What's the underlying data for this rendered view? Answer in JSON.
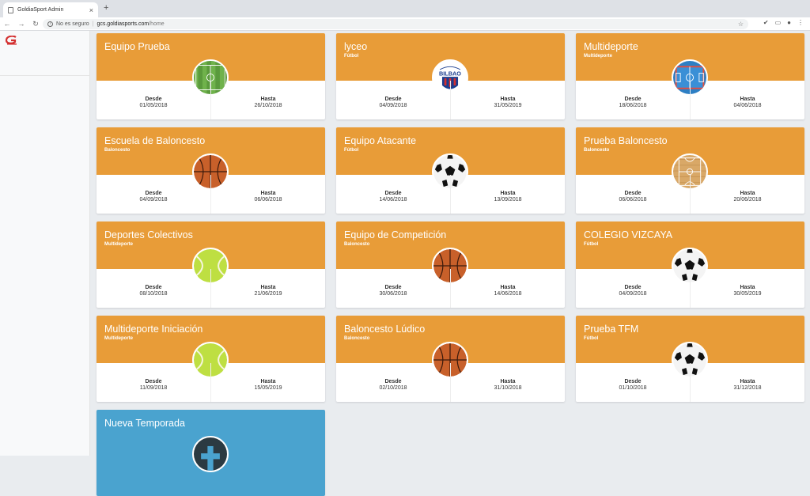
{
  "browser": {
    "tab_title": "GoldiaSport Admin",
    "security_label": "No es seguro",
    "url_host": "gcs.goldiasports.com",
    "url_path": "/home"
  },
  "colors": {
    "orange": "#e89c38",
    "blue": "#4aa3cf"
  },
  "labels": {
    "from": "Desde",
    "to": "Hasta"
  },
  "cards": [
    {
      "title": "Equipo Prueba",
      "subtitle": "",
      "icon": "field-icon",
      "from": "01/05/2018",
      "to": "26/10/2018",
      "color": "orange"
    },
    {
      "title": "lyceo",
      "subtitle": "Fútbol",
      "icon": "bilbao-crest-icon",
      "badge_text": "BILBAO",
      "from": "04/09/2018",
      "to": "31/05/2019",
      "color": "orange"
    },
    {
      "title": "Multideporte",
      "subtitle": "Multideporte",
      "icon": "court-icon",
      "from": "18/06/2018",
      "to": "04/06/2018",
      "color": "orange"
    },
    {
      "title": "Escuela de Baloncesto",
      "subtitle": "Baloncesto",
      "icon": "basketball-icon",
      "from": "04/09/2018",
      "to": "06/06/2018",
      "color": "orange"
    },
    {
      "title": "Equipo Atacante",
      "subtitle": "Fútbol",
      "icon": "soccer-ball-icon",
      "from": "14/06/2018",
      "to": "13/09/2018",
      "color": "orange"
    },
    {
      "title": "Prueba Baloncesto",
      "subtitle": "Baloncesto",
      "icon": "wood-court-icon",
      "from": "06/06/2018",
      "to": "20/06/2018",
      "color": "orange"
    },
    {
      "title": "Deportes Colectivos",
      "subtitle": "Multideporte",
      "icon": "tennis-ball-icon",
      "from": "08/10/2018",
      "to": "21/06/2019",
      "color": "orange"
    },
    {
      "title": "Equipo de Competición",
      "subtitle": "Baloncesto",
      "icon": "basketball-icon",
      "from": "30/06/2018",
      "to": "14/06/2018",
      "color": "orange"
    },
    {
      "title": "COLEGIO VIZCAYA",
      "subtitle": "Fútbol",
      "icon": "soccer-ball-icon",
      "from": "04/09/2018",
      "to": "30/05/2019",
      "color": "orange"
    },
    {
      "title": "Multideporte Iniciación",
      "subtitle": "Multideporte",
      "icon": "tennis-ball-icon",
      "from": "11/09/2018",
      "to": "15/05/2019",
      "color": "orange"
    },
    {
      "title": "Baloncesto Lúdico",
      "subtitle": "Baloncesto",
      "icon": "basketball-icon",
      "from": "02/10/2018",
      "to": "31/10/2018",
      "color": "orange"
    },
    {
      "title": "Prueba TFM",
      "subtitle": "Fútbol",
      "icon": "soccer-ball-icon",
      "from": "01/10/2018",
      "to": "31/12/2018",
      "color": "orange"
    },
    {
      "title": "Nueva Temporada",
      "subtitle": "",
      "icon": "add-icon",
      "from": "",
      "to": "",
      "color": "blue"
    }
  ]
}
